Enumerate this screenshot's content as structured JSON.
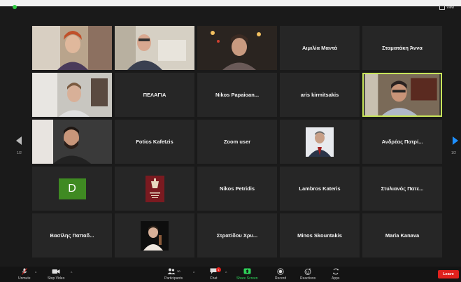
{
  "window": {
    "view_label": "View"
  },
  "pagination": {
    "left": "1/2",
    "right": "1/2"
  },
  "tiles": [
    {
      "name": "",
      "video": true
    },
    {
      "name": "",
      "video": true
    },
    {
      "name": "",
      "video": true
    },
    {
      "name": "Αιμιλία Μαντά",
      "video": false
    },
    {
      "name": "Σταματάκη Άννα",
      "video": false
    },
    {
      "name": "",
      "video": true
    },
    {
      "name": "ΠΕΛΑΓΙΑ",
      "video": false
    },
    {
      "name": "Nikos  Papaioan...",
      "video": false
    },
    {
      "name": "aris kirmitsakis",
      "video": false
    },
    {
      "name": "",
      "video": true,
      "active": true
    },
    {
      "name": "",
      "video": true
    },
    {
      "name": "Fotios Kafetzis",
      "video": false
    },
    {
      "name": "Zoom user",
      "video": false
    },
    {
      "name": "",
      "avatar": "photo"
    },
    {
      "name": "Ανδρέας Πατρί...",
      "video": false
    },
    {
      "name": "",
      "avatar": "letter",
      "letter": "D"
    },
    {
      "name": "",
      "avatar": "logo"
    },
    {
      "name": "Nikos Petridis",
      "video": false
    },
    {
      "name": "Lambros Kateris",
      "video": false
    },
    {
      "name": "Στυλιανός Πατε...",
      "video": false
    },
    {
      "name": "Βασίλης Παπαδ...",
      "video": false
    },
    {
      "name": "",
      "avatar": "photo2"
    },
    {
      "name": "Στρατίδου Χρυ...",
      "video": false
    },
    {
      "name": "Minos Skountakis",
      "video": false
    },
    {
      "name": "Maria Kanava",
      "video": false
    }
  ],
  "toolbar": {
    "unmute": "Unmute",
    "stop_video": "Stop Video",
    "participants": "Participants",
    "participants_count": "30",
    "chat": "Chat",
    "chat_badge": "1",
    "share_screen": "Share Screen",
    "record": "Record",
    "reactions": "Reactions",
    "apps": "Apps",
    "leave": "Leave"
  },
  "colors": {
    "accent_green": "#2fd35a",
    "leave_red": "#e0211d",
    "active_border": "#c8e45a",
    "letter_avatar": "#3f8a22"
  }
}
